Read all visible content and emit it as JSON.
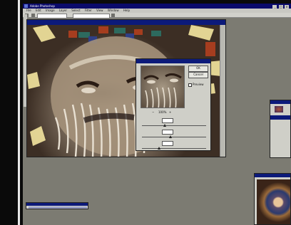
{
  "app": {
    "title": "Adobe Photoshop",
    "menu": [
      "File",
      "Edit",
      "Image",
      "Layer",
      "Select",
      "Filter",
      "View",
      "Window",
      "Help"
    ],
    "window_controls": [
      "_",
      "□",
      "×"
    ]
  },
  "document": {
    "title": ""
  },
  "dialog": {
    "title": "",
    "buttons": {
      "ok": "OK",
      "cancel": "Cancel",
      "load": "Load..."
    },
    "preview_label": "Preview",
    "zoom": {
      "minus": "−",
      "value": "100%",
      "plus": "+"
    },
    "fields": [
      {
        "label": "",
        "value": "",
        "unit": ""
      },
      {
        "label": "",
        "value": "",
        "unit": ""
      },
      {
        "label": "",
        "value": "",
        "unit": ""
      }
    ]
  },
  "icons": [
    "app-logo-icon",
    "zoom-minus-icon",
    "zoom-plus-icon"
  ]
}
